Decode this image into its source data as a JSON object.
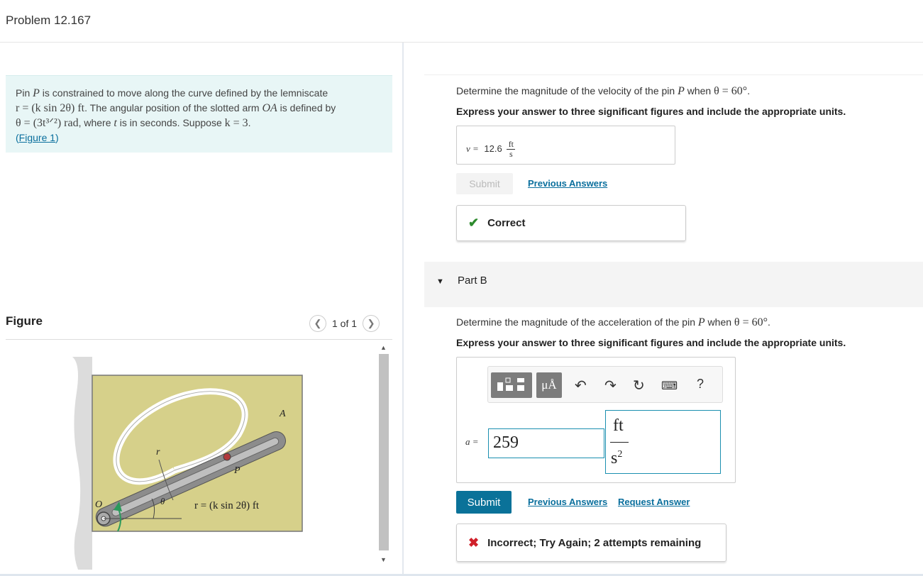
{
  "header": {
    "title": "Problem 12.167"
  },
  "problem": {
    "line1_pre": "Pin ",
    "line1_var": "P",
    "line1_post": " is constrained to move along the curve defined by the lemniscate",
    "line2_eq": "r = (k sin 2θ) ft",
    "line2_post": ". The angular position of the slotted arm ",
    "line2_var": "OA",
    "line2_post2": " is defined by",
    "line3_eq": "θ = (3t³ᐟ²) rad",
    "line3_post": ", where ",
    "line3_var": "t",
    "line3_post2": " is in seconds. Suppose ",
    "line3_eq2": "k = 3",
    "line3_end": ".",
    "figure_link_open": "(",
    "figure_link": "Figure 1",
    "figure_link_close": ")"
  },
  "figure": {
    "label": "Figure",
    "pager": "1 of 1",
    "prev_icon": "chevron-left-icon",
    "next_icon": "chevron-right-icon",
    "labels": {
      "A": "A",
      "r": "r",
      "P": "P",
      "O": "O",
      "theta": "θ",
      "eq": "r = (k sin 2θ) ft"
    }
  },
  "partA": {
    "question_pre": "Determine the magnitude of the velocity of the pin ",
    "question_var": "P",
    "question_post": " when ",
    "question_eq": "θ = 60°",
    "question_end": ".",
    "instruction": "Express your answer to three significant figures and include the appropriate units.",
    "answer_label": "v =",
    "answer_value": "12.6",
    "unit_num": "ft",
    "unit_den": "s",
    "submit_label": "Submit",
    "prev_answers": "Previous Answers",
    "feedback": "Correct"
  },
  "partB": {
    "title": "Part B",
    "question_pre": "Determine the magnitude of the acceleration of the pin ",
    "question_var": "P",
    "question_post": " when ",
    "question_eq": "θ = 60°",
    "question_end": ".",
    "instruction": "Express your answer to three significant figures and include the appropriate units.",
    "toolbar": {
      "units_label": "μÅ",
      "help_label": "?"
    },
    "answer_label": "a =",
    "answer_value": "259",
    "unit_num": "ft",
    "unit_den": "s",
    "unit_exp": "2",
    "submit_label": "Submit",
    "prev_answers": "Previous Answers",
    "request_answer": "Request Answer",
    "feedback": "Incorrect; Try Again; 2 attempts remaining"
  },
  "colors": {
    "link": "#0a6f9d",
    "submit": "#0a7299",
    "correct": "#2d8a2d",
    "incorrect": "#d0202a",
    "problem_bg": "#e8f6f6"
  }
}
